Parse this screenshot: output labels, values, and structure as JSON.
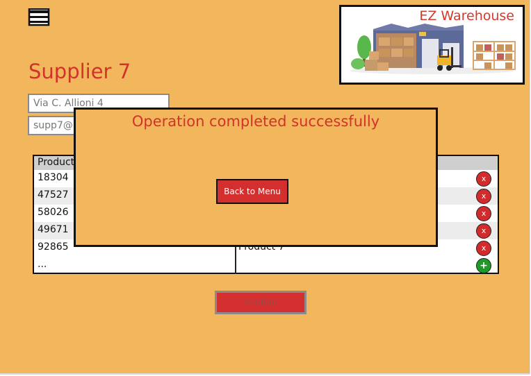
{
  "app": {
    "name": "EZ Warehouse",
    "menu_icon": "hamburger-menu-icon",
    "colors": {
      "background": "#f2b65c",
      "title": "#d3322c",
      "button": "#d32f2f",
      "delete": "#d12b2b",
      "add": "#1f9a2a"
    }
  },
  "page": {
    "title": "Supplier 7",
    "address": "Via C. Allioni 4",
    "email": "supp7@"
  },
  "table": {
    "column_product": "Product",
    "rows": [
      {
        "id": "18304",
        "name": ""
      },
      {
        "id": "47527",
        "name": ""
      },
      {
        "id": "58026",
        "name": ""
      },
      {
        "id": "49671",
        "name": ""
      },
      {
        "id": "92865",
        "name": "Product 7"
      }
    ],
    "ellipsis": "...",
    "delete_label": "x",
    "add_label": "+"
  },
  "confirm_label": "Confirm",
  "modal": {
    "message": "Operation completed successfully",
    "back_label": "Back to Menu"
  }
}
